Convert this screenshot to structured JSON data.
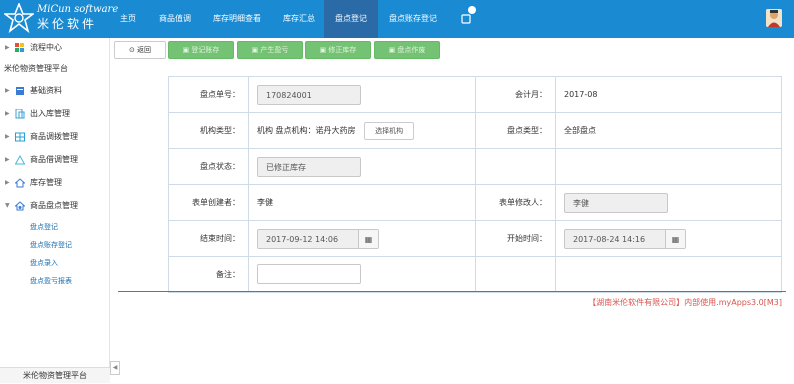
{
  "brand": {
    "en": "MiCun software",
    "cn": "米伦软件"
  },
  "nav": [
    {
      "label": "主页"
    },
    {
      "label": "商品值调"
    },
    {
      "label": "库存明细查看"
    },
    {
      "label": "库存汇总"
    },
    {
      "label": "盘点登记",
      "active": true
    },
    {
      "label": "盘点账存登记"
    }
  ],
  "nav_badge": "6",
  "sidebar": {
    "top_item": "流程中心",
    "section": "米伦物资管理平台",
    "items": [
      {
        "label": "基础资料",
        "icon": "book-icon",
        "color": "#3a7bd5"
      },
      {
        "label": "出入库管理",
        "icon": "document-icon",
        "color": "#3aa0d5"
      },
      {
        "label": "商品调拨管理",
        "icon": "grid-icon",
        "color": "#2a9fd6"
      },
      {
        "label": "商品借调管理",
        "icon": "triangle-icon",
        "color": "#4bb3d9"
      },
      {
        "label": "库存管理",
        "icon": "home-icon",
        "color": "#3a7bd5"
      },
      {
        "label": "商品盘点管理",
        "icon": "house-gear-icon",
        "color": "#3a7bd5"
      }
    ],
    "subitems": [
      {
        "label": "盘点登记"
      },
      {
        "label": "盘点账存登记"
      },
      {
        "label": "盘点录入"
      },
      {
        "label": "盘点盈亏报表"
      }
    ],
    "footer": "米伦物资管理平台"
  },
  "toolbar": {
    "back": "返回",
    "buttons": [
      "登记账存",
      "产生盈亏",
      "修正库存",
      "盘点作废"
    ]
  },
  "form": {
    "order_no_label": "盘点单号：",
    "order_no": "170824001",
    "period_label": "会计月：",
    "period": "2017-08",
    "org_type_label": "机构类型：",
    "org_type": "机构  盘点机构：诺丹大药房",
    "select_org": "选择机构",
    "check_type_label": "盘点类型：",
    "check_type": "全部盘点",
    "status_label": "盘点状态：",
    "status": "已修正库存",
    "creator_label": "表单创建者：",
    "creator": "李健",
    "modifier_label": "表单修改人：",
    "modifier": "李健",
    "end_time_label": "结束时间：",
    "end_time": "2017-09-12 14:06",
    "start_time_label": "开始时间：",
    "start_time": "2017-08-24 14:16",
    "remark_label": "备注：",
    "remark": ""
  },
  "footer_note": "【湖南米伦软件有限公司】内部使用.myApps3.0[M3]",
  "colors": {
    "topbar": "#1a8bd2",
    "active_nav": "#2a6aa6",
    "green_button": "#5cb85c",
    "note": "#d9534f"
  }
}
